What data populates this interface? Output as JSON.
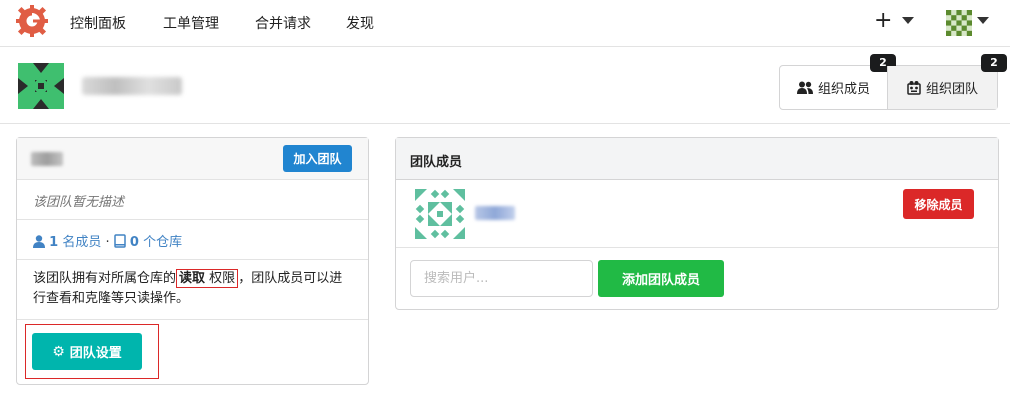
{
  "nav": {
    "items": [
      "控制面板",
      "工单管理",
      "合并请求",
      "发现"
    ],
    "plus": "+"
  },
  "org": {
    "tabs": {
      "members_label": "组织成员",
      "members_count": "2",
      "teams_label": "组织团队",
      "teams_count": "2"
    }
  },
  "team": {
    "join_label": "加入团队",
    "description": "该团队暂无描述",
    "members_count": "1",
    "members_label": "名成员",
    "separator": "·",
    "repos_count": "0",
    "repos_label": "个仓库",
    "perm_prefix": "该团队拥有对所属仓库的",
    "perm_level": "读取",
    "perm_word": "权限",
    "perm_suffix": "，团队成员可以进行查看和克隆等只读操作。",
    "settings_label": "团队设置"
  },
  "members_panel": {
    "title": "团队成员",
    "remove_label": "移除成员",
    "search_placeholder": "搜索用户...",
    "add_label": "添加团队成员"
  },
  "colors": {
    "primary": "#2185d0",
    "teal": "#00b5ad",
    "green": "#21ba45",
    "red": "#db2828",
    "logo": "#e05d44"
  },
  "icons": [
    "gitea-logo-icon",
    "plus-icon",
    "caret-down-icon",
    "users-icon",
    "team-icon",
    "user-icon",
    "book-icon",
    "gear-icon"
  ]
}
